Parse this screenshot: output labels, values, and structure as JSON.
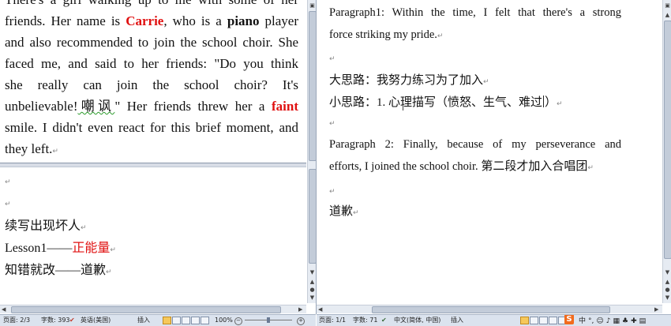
{
  "left_doc": {
    "paragraph_lines": [
      [
        {
          "t": "There's a girl walking up to me with some of her"
        }
      ],
      [
        {
          "t": "friends. Her name is "
        },
        {
          "t": "Carrie",
          "s": "red"
        },
        {
          "t": ", who is a "
        },
        {
          "t": "piano",
          "s": "bold"
        },
        {
          "t": " player"
        }
      ],
      [
        {
          "t": "and also recommended to join the school choir. She"
        }
      ],
      [
        {
          "t": "faced me, and said to her friends: \"Do you think"
        }
      ],
      [
        {
          "t": "she really can join the school choir? It's"
        }
      ],
      [
        {
          "t": "unbelievable!"
        },
        {
          "t": "嘲讽",
          "s": "err"
        },
        {
          "t": "\" Her friends threw her a "
        },
        {
          "t": "faint",
          "s": "red"
        }
      ],
      [
        {
          "t": "smile. I didn't even react for this brief moment, and"
        }
      ],
      [
        {
          "t": "they left."
        }
      ]
    ],
    "line1": "续写出现坏人",
    "line2_prefix": "Lesson1——",
    "line2_highlight": "正能量",
    "line3": "知错就改——道歉"
  },
  "right_doc": {
    "p1_lines": [
      "Paragraph1: Within the time, I felt that there's a strong",
      "force striking my pride."
    ],
    "big_idea": "大思路：我努力练习为了加入",
    "small_idea_before": "小思路：1. 心理描写（愤怒、生气、难过",
    "small_idea_after": "）",
    "p2_lines": [
      "Paragraph 2: Finally, because of my perseverance and"
    ],
    "p2_last_en": "efforts, I joined the school choir.",
    "p2_last_cn": " 第二段才加入合唱团",
    "apology": "道歉"
  },
  "left_status": {
    "page": "页面: 2/3",
    "words": "字数: 393",
    "language": "英语(美国)",
    "mode": "插入",
    "zoom": "100%"
  },
  "right_status": {
    "page": "页面: 1/1",
    "words": "字数: 71",
    "language": "中文(简体, 中国)",
    "mode": "插入",
    "ime": "中"
  },
  "colors": {
    "highlight_red": "#e01010",
    "status_bg": "#dbe3ee",
    "scroll_bg": "#e6ebf2",
    "sogou_orange": "#f26b1d"
  }
}
